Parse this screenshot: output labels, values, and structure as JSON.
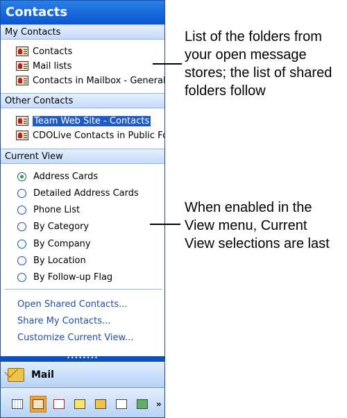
{
  "pane": {
    "title": "Contacts",
    "my_contacts": {
      "header": "My Contacts",
      "items": [
        "Contacts",
        "Mail lists",
        "Contacts in Mailbox - General I"
      ]
    },
    "other_contacts": {
      "header": "Other Contacts",
      "items": [
        "Team Web Site - Contacts",
        "CDOLive Contacts in Public Fol"
      ],
      "selected_index": 0
    },
    "current_view": {
      "header": "Current View",
      "options": [
        "Address Cards",
        "Detailed Address Cards",
        "Phone List",
        "By Category",
        "By Company",
        "By Location",
        "By Follow-up Flag"
      ],
      "selected_index": 0
    },
    "links": [
      "Open Shared Contacts...",
      "Share My Contacts...",
      "Customize Current View..."
    ],
    "mail_button": "Mail",
    "toolbar_icons": [
      "calendar-icon",
      "contacts-icon",
      "tasks-icon",
      "notes-icon",
      "folder-list-icon",
      "shortcuts-icon",
      "journal-icon",
      "configure-buttons-icon"
    ],
    "toolbar_more": "»"
  },
  "annotations": {
    "folders": [
      "List of the folders from",
      "your open message",
      "stores; the list of shared",
      "folders follow"
    ],
    "current_view": [
      "When enabled in the",
      "View menu, Current",
      "View selections are last"
    ]
  },
  "colors": {
    "header_blue": "#0a56d1",
    "selection": "#1f5bc6",
    "link": "#1f4ea6",
    "active_tool": "#f4a232"
  }
}
